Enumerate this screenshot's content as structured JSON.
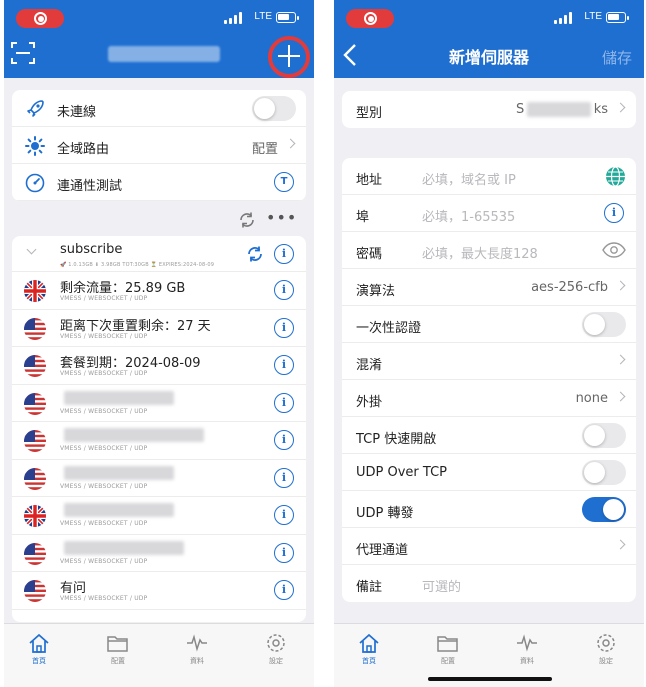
{
  "status": {
    "network": "LTE"
  },
  "left": {
    "connection": {
      "status": "未連線",
      "routing_label": "全域路由",
      "routing_value": "配置",
      "test_label": "連通性測試",
      "test_icon": "T"
    },
    "subscription": {
      "name": "subscribe",
      "stats": "🚀 1.0.13GB ⬇ 3.98GB TOT:30GB ⏳ EXPIRES:2024-08-09"
    },
    "servers": [
      {
        "flag": "uk",
        "name": "剩余流量：25.89 GB",
        "proto": "VMESS / WEBSOCKET / UDP"
      },
      {
        "flag": "us",
        "name": "距离下次重置剩余：27 天",
        "proto": "VMESS / WEBSOCKET / UDP"
      },
      {
        "flag": "us",
        "name": "套餐到期：2024-08-09",
        "proto": "VMESS / WEBSOCKET / UDP"
      },
      {
        "flag": "us",
        "name": "",
        "proto": "VMESS / WEBSOCKET / UDP"
      },
      {
        "flag": "us",
        "name": "",
        "proto": "VMESS / WEBSOCKET / UDP"
      },
      {
        "flag": "us",
        "name": "",
        "proto": "VMESS / WEBSOCKET / UDP"
      },
      {
        "flag": "uk",
        "name": "",
        "proto": "VMESS / WEBSOCKET / UDP"
      },
      {
        "flag": "us",
        "name": "",
        "proto": "VMESS / WEBSOCKET / UDP"
      },
      {
        "flag": "us",
        "name": "有问",
        "proto": "VMESS / WEBSOCKET / UDP"
      }
    ]
  },
  "right": {
    "title": "新增伺服器",
    "save_label": "儲存",
    "type": {
      "label": "型別",
      "prefix": "S",
      "suffix": "ks"
    },
    "form": {
      "address": {
        "label": "地址",
        "placeholder": "必填，域名或 IP"
      },
      "port": {
        "label": "埠",
        "placeholder": "必填，1-65535"
      },
      "password": {
        "label": "密碼",
        "placeholder": "必填，最大長度128"
      },
      "cipher": {
        "label": "演算法",
        "value": "aes-256-cfb"
      },
      "one_time_auth": {
        "label": "一次性認證"
      },
      "obfs": {
        "label": "混淆"
      },
      "plugin": {
        "label": "外掛",
        "value": "none"
      },
      "tcp_fast_open": {
        "label": "TCP 快速開啟"
      },
      "udp_over_tcp": {
        "label": "UDP Over TCP"
      },
      "udp_relay": {
        "label": "UDP 轉發"
      },
      "proxy_chain": {
        "label": "代理通道"
      },
      "remark": {
        "label": "備註",
        "placeholder": "可選的"
      }
    }
  },
  "tabs": [
    {
      "label": "首頁",
      "icon": "home-icon"
    },
    {
      "label": "配置",
      "icon": "folder-icon"
    },
    {
      "label": "資料",
      "icon": "activity-icon"
    },
    {
      "label": "設定",
      "icon": "gear-icon"
    }
  ],
  "colors": {
    "accent": "#1f6fd1",
    "record": "#e23b3b",
    "background": "#efeff4"
  }
}
